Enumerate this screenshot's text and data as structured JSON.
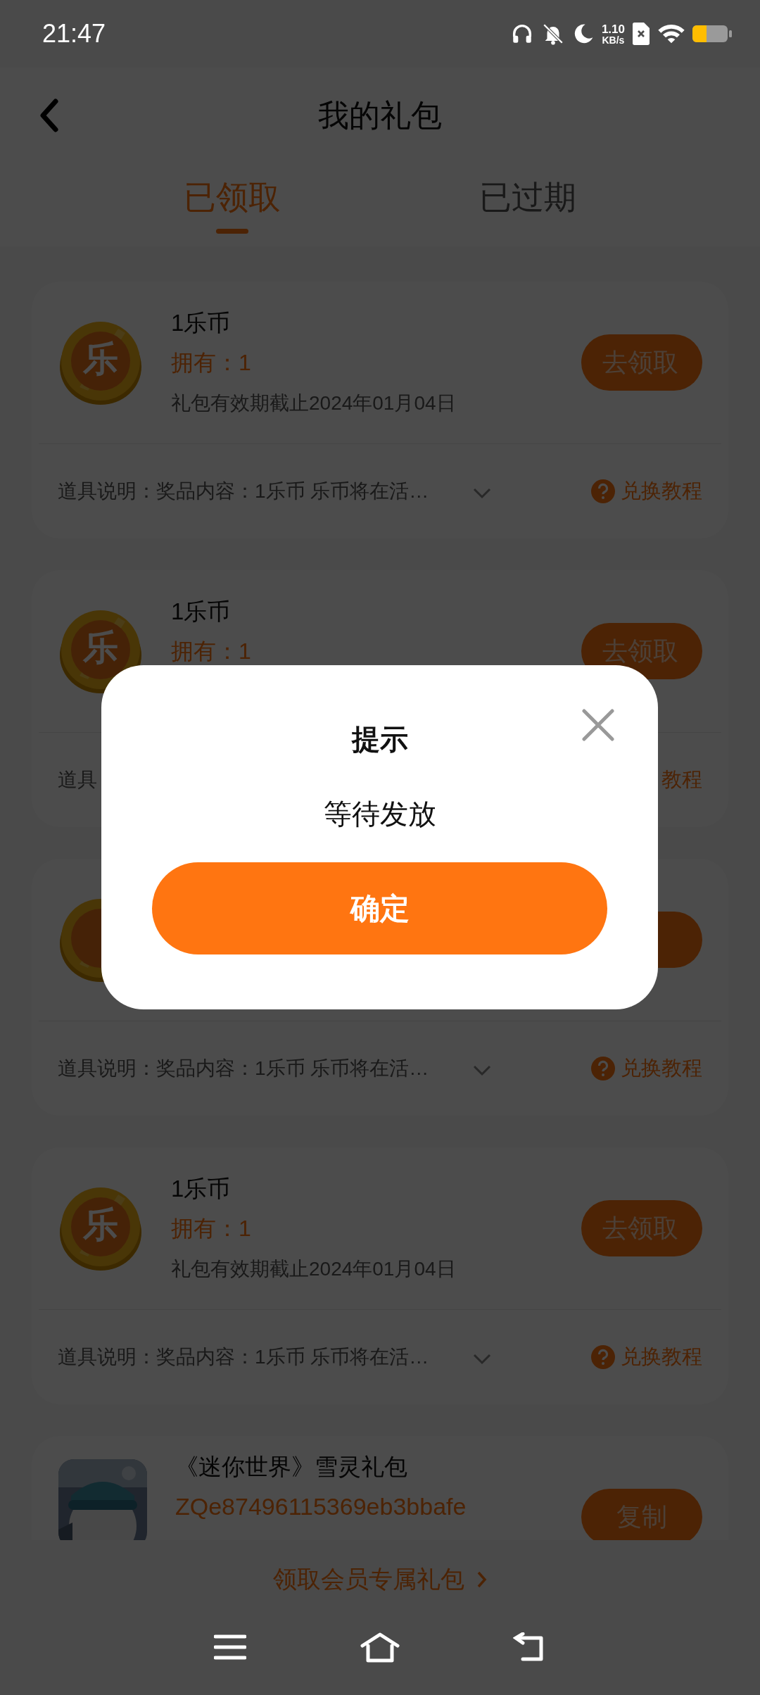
{
  "status_bar": {
    "time": "21:47",
    "net_speed": "1.10",
    "net_unit": "KB/s"
  },
  "header": {
    "title": "我的礼包"
  },
  "tabs": [
    {
      "label": "已领取",
      "selected": true
    },
    {
      "label": "已过期",
      "selected": false
    }
  ],
  "gifts": [
    {
      "kind": "coin",
      "icon_text": "乐",
      "title": "1乐币",
      "owned": "拥有：1",
      "validity": "礼包有效期截止2024年01月04日",
      "button": "去领取",
      "description": "道具说明：奖品内容：1乐币 乐币将在活…",
      "chevron": true,
      "tutorial": "兑换教程",
      "help_icon": true
    },
    {
      "kind": "coin",
      "icon_text": "乐",
      "title": "1乐币",
      "owned": "拥有：1",
      "button": "去领取",
      "description": "道具",
      "chevron": false,
      "tutorial": "教程",
      "help_icon": false
    },
    {
      "kind": "coin",
      "description": "道具说明：奖品内容：1乐币 乐币将在活…",
      "chevron": true,
      "tutorial": "兑换教程",
      "help_icon": true
    },
    {
      "kind": "coin",
      "icon_text": "乐",
      "title": "1乐币",
      "owned": "拥有：1",
      "validity": "礼包有效期截止2024年01月04日",
      "button": "去领取",
      "description": "道具说明：奖品内容：1乐币 乐币将在活…",
      "chevron": true,
      "tutorial": "兑换教程",
      "help_icon": true
    },
    {
      "kind": "code",
      "title": "《迷你世界》雪灵礼包",
      "code": "ZQe87496115369eb3bbafe",
      "button": "复制"
    }
  ],
  "footer_link": "领取会员专属礼包",
  "dialog": {
    "title": "提示",
    "message": "等待发放",
    "confirm": "确定"
  }
}
